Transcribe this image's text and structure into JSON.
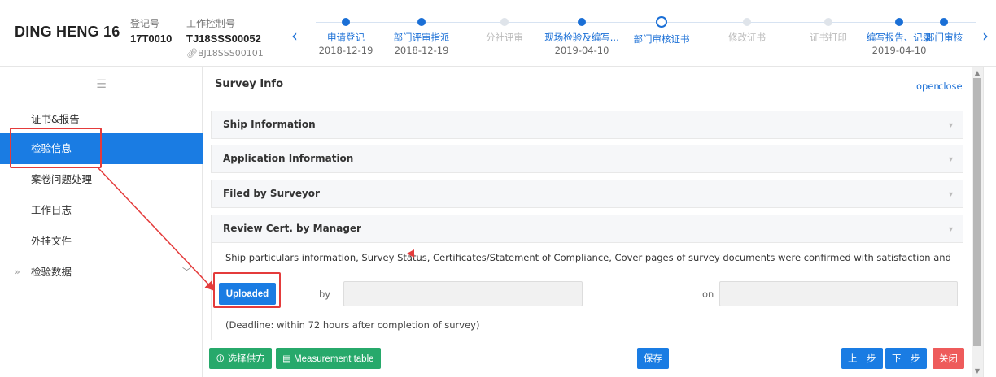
{
  "header": {
    "ship_name": "DING HENG 16",
    "reg_label": "登记号",
    "reg_value": "17T0010",
    "job_label": "工作控制号",
    "job_value": "TJ18SSS00052",
    "job_sub": "BJ18SSS00101",
    "prev_arrow": "‹",
    "next_arrow": "›"
  },
  "steps": [
    {
      "name": "申请登记",
      "date": "2018-12-19",
      "state": "done"
    },
    {
      "name": "部门评审指派",
      "date": "2018-12-19",
      "state": "done"
    },
    {
      "name": "分社评审",
      "date": "",
      "state": "muted"
    },
    {
      "name": "现场检验及编写...",
      "date": "2019-04-10",
      "state": "done"
    },
    {
      "name": "部门审核证书",
      "date": "",
      "state": "current"
    },
    {
      "name": "修改证书",
      "date": "",
      "state": "muted"
    },
    {
      "name": "证书打印",
      "date": "",
      "state": "muted"
    },
    {
      "name": "编写报告、记录",
      "date": "2019-04-10",
      "state": "done"
    },
    {
      "name": "部门审核",
      "date": "",
      "state": "done-cut"
    }
  ],
  "sidebar": {
    "collapse_icon": "☰",
    "items": [
      {
        "label": "证书&报告"
      },
      {
        "label": "检验信息"
      },
      {
        "label": "案卷问题处理"
      },
      {
        "label": "工作日志"
      },
      {
        "label": "外挂文件"
      },
      {
        "label": "检验数据"
      }
    ]
  },
  "main": {
    "title": "Survey Info",
    "open_label": "open",
    "close_label": "close",
    "panels": [
      {
        "label": "Ship Information"
      },
      {
        "label": "Application Information"
      },
      {
        "label": "Filed by Surveyor"
      },
      {
        "label": "Review Cert. by Manager"
      }
    ],
    "review": {
      "text": "Ship particulars information, Survey Status, Certificates/Statement of Compliance, Cover pages of survey documents were confirmed with satisfaction and",
      "button": "Uploaded",
      "by_label": "by",
      "by_value": "",
      "on_label": "on",
      "on_value": "",
      "deadline": "(Deadline: within 72 hours after completion of survey)"
    }
  },
  "footer": {
    "select_supplier": "选择供方",
    "measurement": "Measurement table",
    "save": "保存",
    "prev": "上一步",
    "next": "下一步",
    "close": "关闭"
  },
  "colors": {
    "accent": "#1a7ce3",
    "annotation": "#e43b3b",
    "green": "#27a96b",
    "danger": "#ee5b5b"
  }
}
